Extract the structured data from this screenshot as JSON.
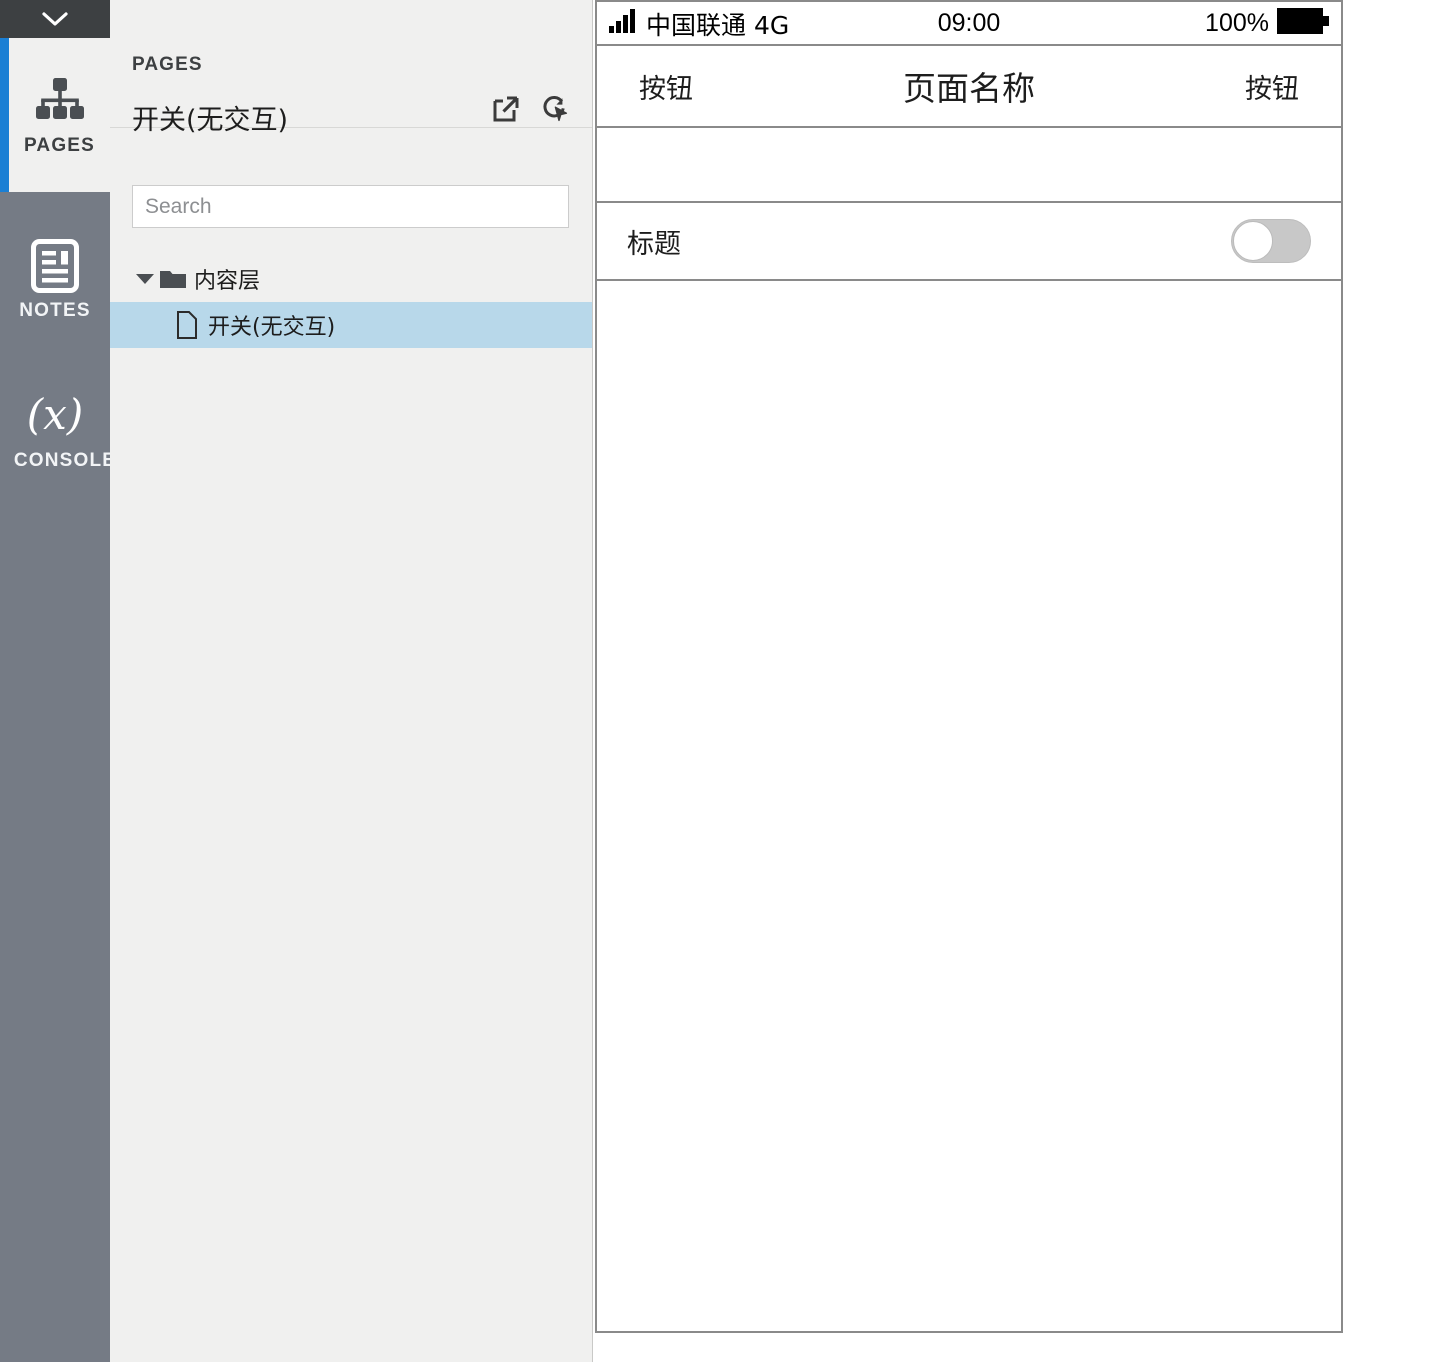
{
  "rail": {
    "collapse_icon": "chevron-down-icon",
    "tabs": [
      {
        "label": "PAGES",
        "icon": "sitemap-icon",
        "active": true
      },
      {
        "label": "NOTES",
        "icon": "document-lines-icon",
        "active": false
      },
      {
        "label": "CONSOLE",
        "icon": "variable-x-icon",
        "active": false
      }
    ]
  },
  "panel": {
    "eyebrow": "PAGES",
    "title": "开关(无交互)",
    "actions": [
      {
        "name": "open-in-new-window-icon",
        "tooltip": "Open in new window"
      },
      {
        "name": "reload-cursor-icon",
        "tooltip": "Reload"
      }
    ],
    "search": {
      "value": "",
      "placeholder": "Search"
    },
    "tree": [
      {
        "label": "内容层",
        "type": "folder",
        "expanded": true,
        "depth": 0,
        "selected": false
      },
      {
        "label": "开关(无交互)",
        "type": "page",
        "expanded": false,
        "depth": 1,
        "selected": true
      }
    ]
  },
  "preview": {
    "statusbar": {
      "signal_icon": "signal-bars-icon",
      "carrier": "中国联通 4G",
      "time": "09:00",
      "battery_percent": "100%",
      "battery_icon": "battery-full-icon"
    },
    "navbar": {
      "left_button": "按钮",
      "title": "页面名称",
      "right_button": "按钮"
    },
    "rows": [
      {
        "type": "spacer"
      },
      {
        "type": "toggle",
        "label": "标题",
        "state": "off"
      },
      {
        "type": "content"
      }
    ]
  },
  "colors": {
    "accent_blue": "#1a7fd4",
    "rail_gray": "#757b85",
    "rail_header": "#3d4042",
    "panel_bg": "#f0f0ef",
    "selection_blue": "#b8d8ea",
    "switch_track_off": "#c8c8c8"
  }
}
